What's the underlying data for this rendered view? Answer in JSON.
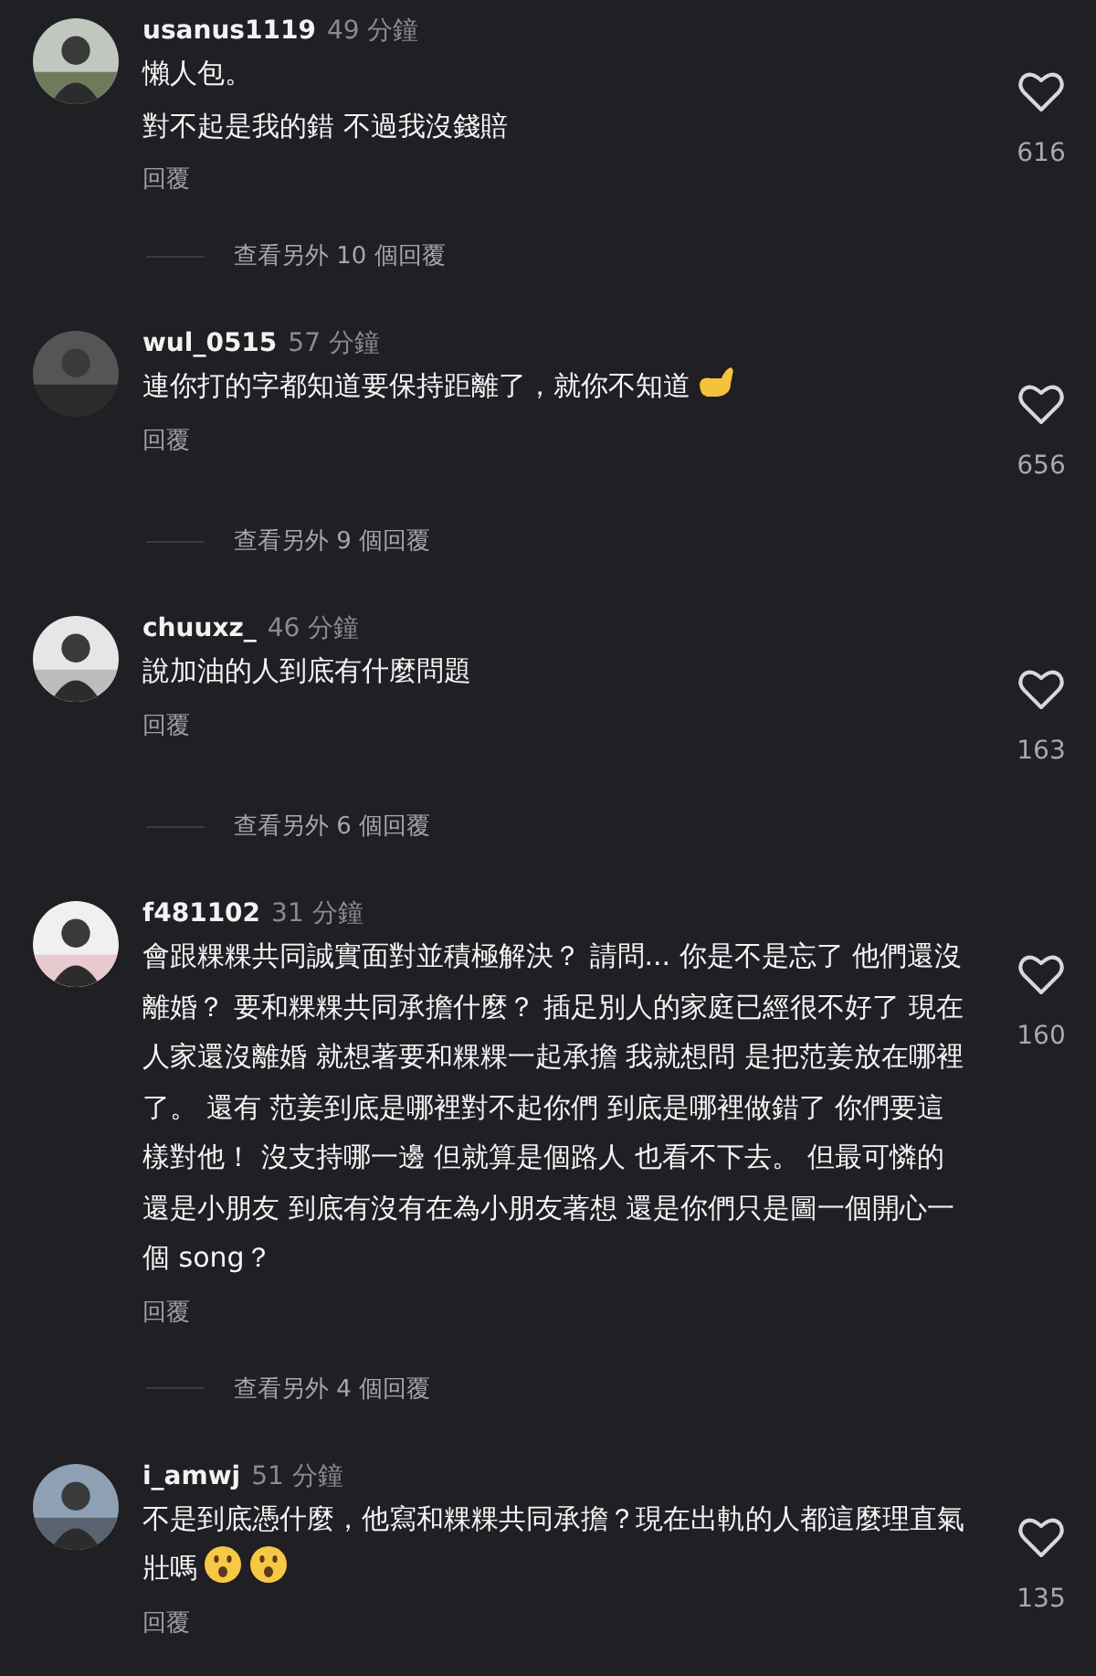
{
  "comments": [
    {
      "username": "usanus1119",
      "time": "49 分鐘",
      "lines": [
        "懶人包。",
        "對不起是我的錯 不過我沒錢賠"
      ],
      "reply": "回覆",
      "likes": "616",
      "more_replies": "查看另外 10 個回覆"
    },
    {
      "username": "wul_0515",
      "time": "57 分鐘",
      "lines": [
        "連你打的字都知道要保持距離了，就你不知道"
      ],
      "emojis": [
        {
          "kind": "hand"
        }
      ],
      "reply": "回覆",
      "likes": "656",
      "more_replies": "查看另外 9 個回覆"
    },
    {
      "username": "chuuxz_",
      "time": "46 分鐘",
      "lines": [
        "說加油的人到底有什麼問題"
      ],
      "reply": "回覆",
      "likes": "163",
      "more_replies": "查看另外 6 個回覆"
    },
    {
      "username": "f481102",
      "time": "31 分鐘",
      "lines": [
        "會跟粿粿共同誠實面對並積極解決？ 請問... 你是不是忘了 他們還沒離婚？ 要和粿粿共同承擔什麼？ 插足別人的家庭已經很不好了 現在人家還沒離婚 就想著要和粿粿一起承擔 我就想問 是把范姜放在哪裡了。 還有 范姜到底是哪裡對不起你們 到底是哪裡做錯了 你們要這樣對他！ 沒支持哪一邊 但就算是個路人 也看不下去。 但最可憐的還是小朋友 到底有沒有在為小朋友著想 還是你們只是圖一個開心一個 song？"
      ],
      "reply": "回覆",
      "likes": "160",
      "more_replies": "查看另外 4 個回覆"
    },
    {
      "username": "i_amwj",
      "time": "51 分鐘",
      "lines": [
        "不是到底憑什麼，他寫和粿粿共同承擔？現在出軌的人都這麼理直氣壯嗎"
      ],
      "emojis": [
        {
          "kind": "face"
        },
        {
          "kind": "face"
        }
      ],
      "reply": "回覆",
      "likes": "135"
    }
  ]
}
